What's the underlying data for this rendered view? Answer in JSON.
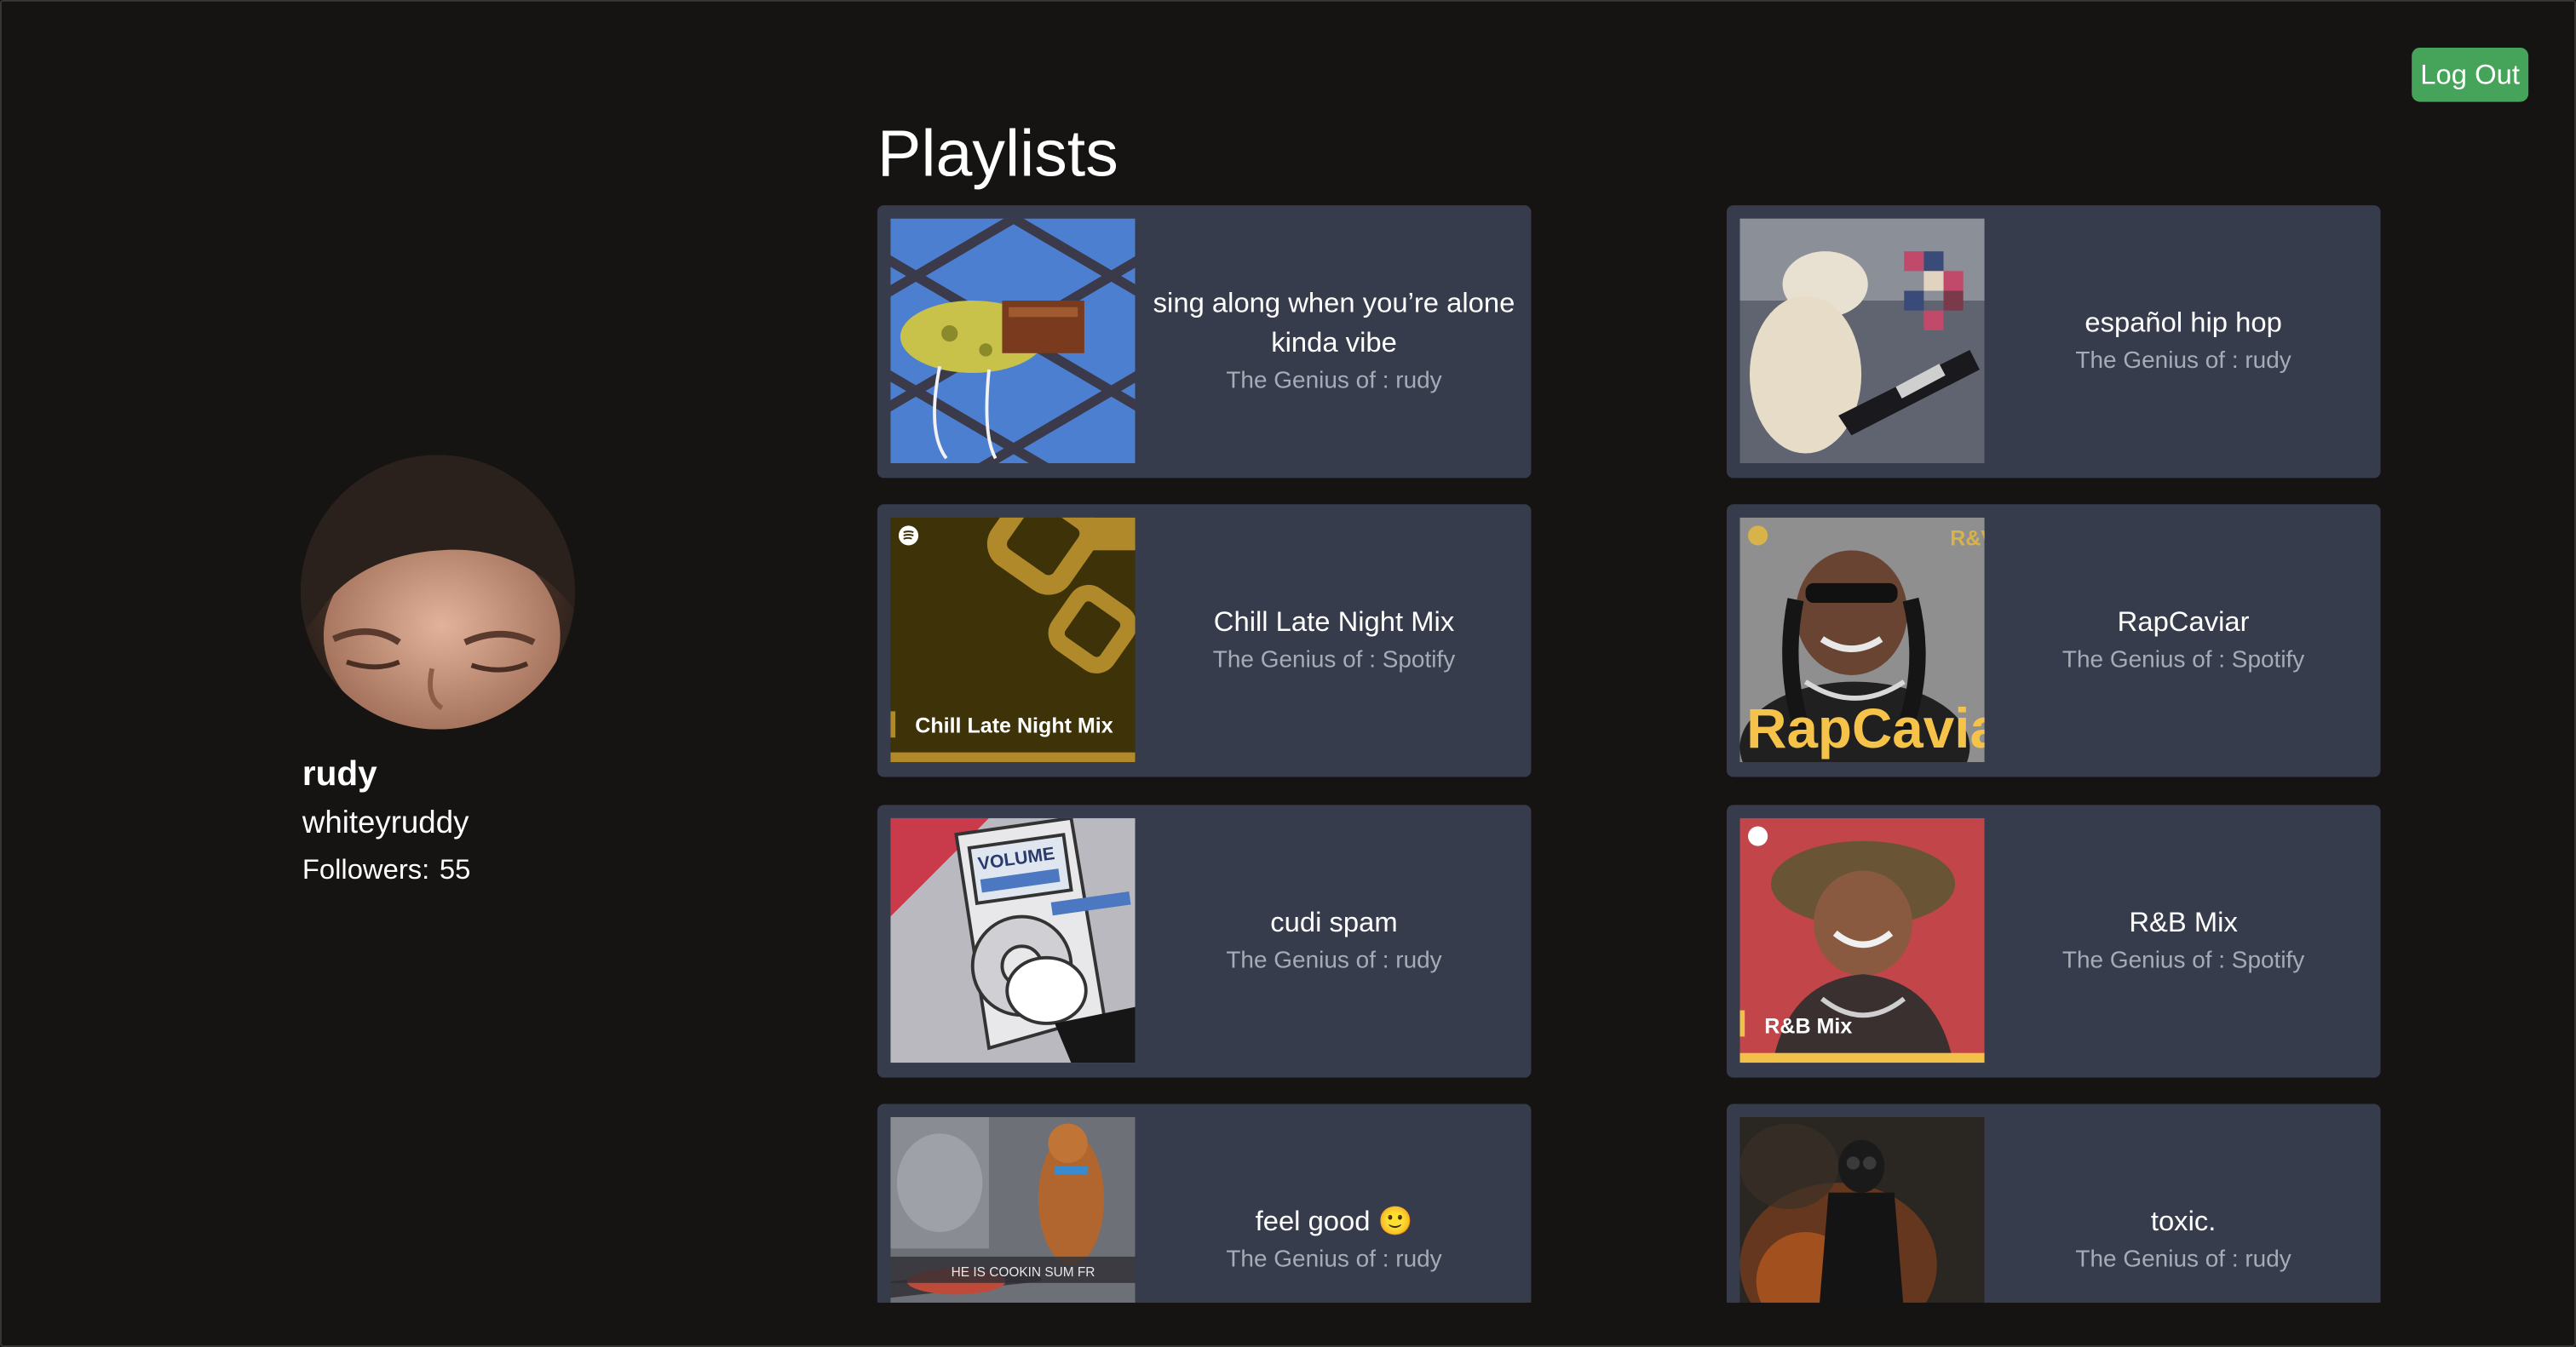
{
  "header": {
    "logout_label": "Log Out"
  },
  "profile": {
    "name": "rudy",
    "username": "whiteyruddy",
    "followers_label": "Followers:",
    "followers_count": "55"
  },
  "page": {
    "heading": "Playlists"
  },
  "owner_prefix": "The Genius of :",
  "playlists": [
    {
      "title": "sing along when you’re alone kinda vibe",
      "owner": "rudy"
    },
    {
      "title": "español hip hop",
      "owner": "rudy"
    },
    {
      "title": "Chill Late Night Mix",
      "owner": "Spotify",
      "cover_text": "Chill Late Night Mix"
    },
    {
      "title": "RapCaviar",
      "owner": "Spotify",
      "cover_text": "RapCaviar",
      "cover_badge": "R&V"
    },
    {
      "title": "cudi spam",
      "owner": "rudy",
      "cover_text": "VOLUME"
    },
    {
      "title": "R&B Mix",
      "owner": "Spotify",
      "cover_text": "R&B Mix"
    },
    {
      "title": "feel good 🙂",
      "owner": "rudy",
      "cover_text": "HE IS COOKIN SUM FR"
    },
    {
      "title": "toxic.",
      "owner": "rudy"
    }
  ]
}
